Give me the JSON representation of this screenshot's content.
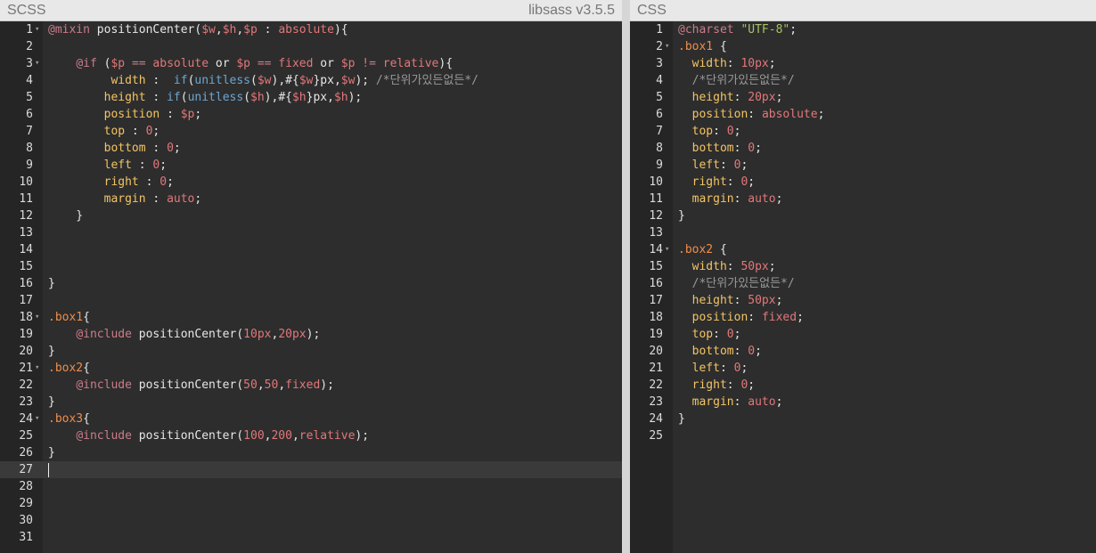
{
  "scss_panel": {
    "title": "SCSS",
    "version": "libsass v3.5.5",
    "cursor_line": 27,
    "lines": [
      {
        "n": "1",
        "fold": true,
        "tokens": [
          [
            "kw",
            "@mixin"
          ],
          [
            "plain",
            " positionCenter("
          ],
          [
            "var",
            "$w"
          ],
          [
            "plain",
            ","
          ],
          [
            "var",
            "$h"
          ],
          [
            "plain",
            ","
          ],
          [
            "var",
            "$p"
          ],
          [
            "plain",
            " : "
          ],
          [
            "num",
            "absolute"
          ],
          [
            "plain",
            "){"
          ]
        ]
      },
      {
        "n": "2",
        "fold": false,
        "tokens": []
      },
      {
        "n": "3",
        "fold": true,
        "tokens": [
          [
            "plain",
            "    "
          ],
          [
            "kw",
            "@if"
          ],
          [
            "plain",
            " ("
          ],
          [
            "var",
            "$p"
          ],
          [
            "plain",
            " "
          ],
          [
            "op",
            "=="
          ],
          [
            "plain",
            " "
          ],
          [
            "num",
            "absolute"
          ],
          [
            "plain",
            " or "
          ],
          [
            "var",
            "$p"
          ],
          [
            "plain",
            " "
          ],
          [
            "op",
            "=="
          ],
          [
            "plain",
            " "
          ],
          [
            "num",
            "fixed"
          ],
          [
            "plain",
            " or "
          ],
          [
            "var",
            "$p"
          ],
          [
            "plain",
            " "
          ],
          [
            "op",
            "!="
          ],
          [
            "plain",
            " "
          ],
          [
            "num",
            "relative"
          ],
          [
            "plain",
            "){"
          ]
        ]
      },
      {
        "n": "4",
        "fold": false,
        "tokens": [
          [
            "plain",
            "         "
          ],
          [
            "prop",
            "width"
          ],
          [
            "plain",
            " :  "
          ],
          [
            "fn",
            "if"
          ],
          [
            "plain",
            "("
          ],
          [
            "fn",
            "unitless"
          ],
          [
            "plain",
            "("
          ],
          [
            "var",
            "$w"
          ],
          [
            "plain",
            "),#{"
          ],
          [
            "var",
            "$w"
          ],
          [
            "plain",
            "}px,"
          ],
          [
            "var",
            "$w"
          ],
          [
            "plain",
            "); "
          ],
          [
            "com",
            "/*단위가있든없든*/"
          ]
        ]
      },
      {
        "n": "5",
        "fold": false,
        "tokens": [
          [
            "plain",
            "        "
          ],
          [
            "prop",
            "height"
          ],
          [
            "plain",
            " : "
          ],
          [
            "fn",
            "if"
          ],
          [
            "plain",
            "("
          ],
          [
            "fn",
            "unitless"
          ],
          [
            "plain",
            "("
          ],
          [
            "var",
            "$h"
          ],
          [
            "plain",
            "),#{"
          ],
          [
            "var",
            "$h"
          ],
          [
            "plain",
            "}px,"
          ],
          [
            "var",
            "$h"
          ],
          [
            "plain",
            ");"
          ]
        ]
      },
      {
        "n": "6",
        "fold": false,
        "tokens": [
          [
            "plain",
            "        "
          ],
          [
            "prop",
            "position"
          ],
          [
            "plain",
            " : "
          ],
          [
            "var",
            "$p"
          ],
          [
            "plain",
            ";"
          ]
        ]
      },
      {
        "n": "7",
        "fold": false,
        "tokens": [
          [
            "plain",
            "        "
          ],
          [
            "prop",
            "top"
          ],
          [
            "plain",
            " : "
          ],
          [
            "num",
            "0"
          ],
          [
            "plain",
            ";"
          ]
        ]
      },
      {
        "n": "8",
        "fold": false,
        "tokens": [
          [
            "plain",
            "        "
          ],
          [
            "prop",
            "bottom"
          ],
          [
            "plain",
            " : "
          ],
          [
            "num",
            "0"
          ],
          [
            "plain",
            ";"
          ]
        ]
      },
      {
        "n": "9",
        "fold": false,
        "tokens": [
          [
            "plain",
            "        "
          ],
          [
            "prop",
            "left"
          ],
          [
            "plain",
            " : "
          ],
          [
            "num",
            "0"
          ],
          [
            "plain",
            ";"
          ]
        ]
      },
      {
        "n": "10",
        "fold": false,
        "tokens": [
          [
            "plain",
            "        "
          ],
          [
            "prop",
            "right"
          ],
          [
            "plain",
            " : "
          ],
          [
            "num",
            "0"
          ],
          [
            "plain",
            ";"
          ]
        ]
      },
      {
        "n": "11",
        "fold": false,
        "tokens": [
          [
            "plain",
            "        "
          ],
          [
            "prop",
            "margin"
          ],
          [
            "plain",
            " : "
          ],
          [
            "num",
            "auto"
          ],
          [
            "plain",
            ";"
          ]
        ]
      },
      {
        "n": "12",
        "fold": false,
        "tokens": [
          [
            "plain",
            "    }"
          ]
        ]
      },
      {
        "n": "13",
        "fold": false,
        "tokens": []
      },
      {
        "n": "14",
        "fold": false,
        "tokens": []
      },
      {
        "n": "15",
        "fold": false,
        "tokens": []
      },
      {
        "n": "16",
        "fold": false,
        "tokens": [
          [
            "plain",
            "}"
          ]
        ]
      },
      {
        "n": "17",
        "fold": false,
        "tokens": []
      },
      {
        "n": "18",
        "fold": true,
        "tokens": [
          [
            "sel",
            ".box1"
          ],
          [
            "plain",
            "{"
          ]
        ]
      },
      {
        "n": "19",
        "fold": false,
        "tokens": [
          [
            "plain",
            "    "
          ],
          [
            "kw",
            "@include"
          ],
          [
            "plain",
            " positionCenter("
          ],
          [
            "num",
            "10px"
          ],
          [
            "plain",
            ","
          ],
          [
            "num",
            "20px"
          ],
          [
            "plain",
            ");"
          ]
        ]
      },
      {
        "n": "20",
        "fold": false,
        "tokens": [
          [
            "plain",
            "}"
          ]
        ]
      },
      {
        "n": "21",
        "fold": true,
        "tokens": [
          [
            "sel",
            ".box2"
          ],
          [
            "plain",
            "{"
          ]
        ]
      },
      {
        "n": "22",
        "fold": false,
        "tokens": [
          [
            "plain",
            "    "
          ],
          [
            "kw",
            "@include"
          ],
          [
            "plain",
            " positionCenter("
          ],
          [
            "num",
            "50"
          ],
          [
            "plain",
            ","
          ],
          [
            "num",
            "50"
          ],
          [
            "plain",
            ","
          ],
          [
            "num",
            "fixed"
          ],
          [
            "plain",
            ");"
          ]
        ]
      },
      {
        "n": "23",
        "fold": false,
        "tokens": [
          [
            "plain",
            "}"
          ]
        ]
      },
      {
        "n": "24",
        "fold": true,
        "tokens": [
          [
            "sel",
            ".box3"
          ],
          [
            "plain",
            "{"
          ]
        ]
      },
      {
        "n": "25",
        "fold": false,
        "tokens": [
          [
            "plain",
            "    "
          ],
          [
            "kw",
            "@include"
          ],
          [
            "plain",
            " positionCenter("
          ],
          [
            "num",
            "100"
          ],
          [
            "plain",
            ","
          ],
          [
            "num",
            "200"
          ],
          [
            "plain",
            ","
          ],
          [
            "num",
            "relative"
          ],
          [
            "plain",
            ");"
          ]
        ]
      },
      {
        "n": "26",
        "fold": false,
        "tokens": [
          [
            "plain",
            "}"
          ]
        ]
      },
      {
        "n": "27",
        "fold": false,
        "tokens": []
      },
      {
        "n": "28",
        "fold": false,
        "tokens": []
      },
      {
        "n": "29",
        "fold": false,
        "tokens": []
      },
      {
        "n": "30",
        "fold": false,
        "tokens": []
      },
      {
        "n": "31",
        "fold": false,
        "tokens": []
      }
    ]
  },
  "css_panel": {
    "title": "CSS",
    "lines": [
      {
        "n": "1",
        "fold": false,
        "tokens": [
          [
            "kw",
            "@charset"
          ],
          [
            "plain",
            " "
          ],
          [
            "str",
            "\"UTF-8\""
          ],
          [
            "plain",
            ";"
          ]
        ]
      },
      {
        "n": "2",
        "fold": true,
        "tokens": [
          [
            "sel",
            ".box1"
          ],
          [
            "plain",
            " {"
          ]
        ]
      },
      {
        "n": "3",
        "fold": false,
        "tokens": [
          [
            "plain",
            "  "
          ],
          [
            "prop",
            "width"
          ],
          [
            "plain",
            ": "
          ],
          [
            "num",
            "10px"
          ],
          [
            "plain",
            ";"
          ]
        ]
      },
      {
        "n": "4",
        "fold": false,
        "tokens": [
          [
            "plain",
            "  "
          ],
          [
            "com",
            "/*단위가있든없든*/"
          ]
        ]
      },
      {
        "n": "5",
        "fold": false,
        "tokens": [
          [
            "plain",
            "  "
          ],
          [
            "prop",
            "height"
          ],
          [
            "plain",
            ": "
          ],
          [
            "num",
            "20px"
          ],
          [
            "plain",
            ";"
          ]
        ]
      },
      {
        "n": "6",
        "fold": false,
        "tokens": [
          [
            "plain",
            "  "
          ],
          [
            "prop",
            "position"
          ],
          [
            "plain",
            ": "
          ],
          [
            "num",
            "absolute"
          ],
          [
            "plain",
            ";"
          ]
        ]
      },
      {
        "n": "7",
        "fold": false,
        "tokens": [
          [
            "plain",
            "  "
          ],
          [
            "prop",
            "top"
          ],
          [
            "plain",
            ": "
          ],
          [
            "num",
            "0"
          ],
          [
            "plain",
            ";"
          ]
        ]
      },
      {
        "n": "8",
        "fold": false,
        "tokens": [
          [
            "plain",
            "  "
          ],
          [
            "prop",
            "bottom"
          ],
          [
            "plain",
            ": "
          ],
          [
            "num",
            "0"
          ],
          [
            "plain",
            ";"
          ]
        ]
      },
      {
        "n": "9",
        "fold": false,
        "tokens": [
          [
            "plain",
            "  "
          ],
          [
            "prop",
            "left"
          ],
          [
            "plain",
            ": "
          ],
          [
            "num",
            "0"
          ],
          [
            "plain",
            ";"
          ]
        ]
      },
      {
        "n": "10",
        "fold": false,
        "tokens": [
          [
            "plain",
            "  "
          ],
          [
            "prop",
            "right"
          ],
          [
            "plain",
            ": "
          ],
          [
            "num",
            "0"
          ],
          [
            "plain",
            ";"
          ]
        ]
      },
      {
        "n": "11",
        "fold": false,
        "tokens": [
          [
            "plain",
            "  "
          ],
          [
            "prop",
            "margin"
          ],
          [
            "plain",
            ": "
          ],
          [
            "num",
            "auto"
          ],
          [
            "plain",
            ";"
          ]
        ]
      },
      {
        "n": "12",
        "fold": false,
        "tokens": [
          [
            "plain",
            "}"
          ]
        ]
      },
      {
        "n": "13",
        "fold": false,
        "tokens": []
      },
      {
        "n": "14",
        "fold": true,
        "tokens": [
          [
            "sel",
            ".box2"
          ],
          [
            "plain",
            " {"
          ]
        ]
      },
      {
        "n": "15",
        "fold": false,
        "tokens": [
          [
            "plain",
            "  "
          ],
          [
            "prop",
            "width"
          ],
          [
            "plain",
            ": "
          ],
          [
            "num",
            "50px"
          ],
          [
            "plain",
            ";"
          ]
        ]
      },
      {
        "n": "16",
        "fold": false,
        "tokens": [
          [
            "plain",
            "  "
          ],
          [
            "com",
            "/*단위가있든없든*/"
          ]
        ]
      },
      {
        "n": "17",
        "fold": false,
        "tokens": [
          [
            "plain",
            "  "
          ],
          [
            "prop",
            "height"
          ],
          [
            "plain",
            ": "
          ],
          [
            "num",
            "50px"
          ],
          [
            "plain",
            ";"
          ]
        ]
      },
      {
        "n": "18",
        "fold": false,
        "tokens": [
          [
            "plain",
            "  "
          ],
          [
            "prop",
            "position"
          ],
          [
            "plain",
            ": "
          ],
          [
            "num",
            "fixed"
          ],
          [
            "plain",
            ";"
          ]
        ]
      },
      {
        "n": "19",
        "fold": false,
        "tokens": [
          [
            "plain",
            "  "
          ],
          [
            "prop",
            "top"
          ],
          [
            "plain",
            ": "
          ],
          [
            "num",
            "0"
          ],
          [
            "plain",
            ";"
          ]
        ]
      },
      {
        "n": "20",
        "fold": false,
        "tokens": [
          [
            "plain",
            "  "
          ],
          [
            "prop",
            "bottom"
          ],
          [
            "plain",
            ": "
          ],
          [
            "num",
            "0"
          ],
          [
            "plain",
            ";"
          ]
        ]
      },
      {
        "n": "21",
        "fold": false,
        "tokens": [
          [
            "plain",
            "  "
          ],
          [
            "prop",
            "left"
          ],
          [
            "plain",
            ": "
          ],
          [
            "num",
            "0"
          ],
          [
            "plain",
            ";"
          ]
        ]
      },
      {
        "n": "22",
        "fold": false,
        "tokens": [
          [
            "plain",
            "  "
          ],
          [
            "prop",
            "right"
          ],
          [
            "plain",
            ": "
          ],
          [
            "num",
            "0"
          ],
          [
            "plain",
            ";"
          ]
        ]
      },
      {
        "n": "23",
        "fold": false,
        "tokens": [
          [
            "plain",
            "  "
          ],
          [
            "prop",
            "margin"
          ],
          [
            "plain",
            ": "
          ],
          [
            "num",
            "auto"
          ],
          [
            "plain",
            ";"
          ]
        ]
      },
      {
        "n": "24",
        "fold": false,
        "tokens": [
          [
            "plain",
            "}"
          ]
        ]
      },
      {
        "n": "25",
        "fold": false,
        "tokens": []
      }
    ]
  },
  "colors": {
    "editor_bg": "#2d2d2d",
    "gutter_bg": "#252525",
    "header_bg": "#e8e8e8",
    "active_line": "#3a3a3a"
  }
}
